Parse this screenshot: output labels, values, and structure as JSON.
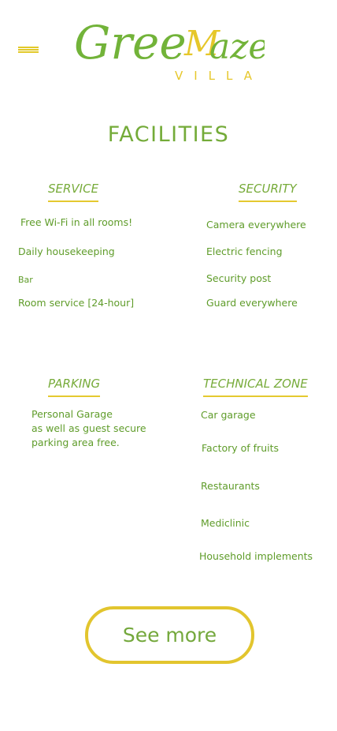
{
  "header": {
    "menu_icon": "hamburger-menu-icon",
    "logo": {
      "wordmark_part1": "Gree",
      "wordmark_part2": "M",
      "wordmark_part3": "aze",
      "subtitle": "VILLA",
      "green": "#72b339",
      "yellow": "#e6c72a"
    }
  },
  "main": {
    "title": "FACILITIES",
    "sections": {
      "service": {
        "heading": "SERVICE",
        "items": [
          "Free Wi-Fi in all rooms!",
          "Daily housekeeping",
          "Bar",
          "Room service [24-hour]"
        ]
      },
      "security": {
        "heading": "SECURITY",
        "items": [
          "Camera everywhere",
          "Electric fencing",
          "Security post",
          "Guard everywhere"
        ]
      },
      "parking": {
        "heading": "PARKING",
        "text": "Personal Garage\nas well as guest secure\nparking area free."
      },
      "technical_zone": {
        "heading": "TECHNICAL ZONE",
        "items": [
          "Car garage",
          "Factory of fruits",
          "Restaurants",
          "Mediclinic",
          "Household implements"
        ]
      }
    },
    "cta": {
      "label": "See more"
    }
  },
  "colors": {
    "accent_green": "#6aab35",
    "accent_yellow": "#e2c52e",
    "background": "#ffffff"
  }
}
